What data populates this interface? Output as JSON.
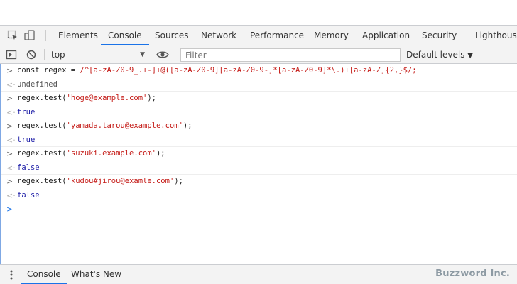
{
  "devtools": {
    "tabs": [
      {
        "label": "Elements",
        "active": false
      },
      {
        "label": "Console",
        "active": true
      },
      {
        "label": "Sources",
        "active": false
      },
      {
        "label": "Network",
        "active": false
      },
      {
        "label": "Performance",
        "active": false
      },
      {
        "label": "Memory",
        "active": false
      },
      {
        "label": "Application",
        "active": false
      },
      {
        "label": "Security",
        "active": false
      },
      {
        "label": "Lighthouse",
        "active": false
      }
    ]
  },
  "toolbar": {
    "context": "top",
    "filter_placeholder": "Filter",
    "filter_value": "",
    "levels_label": "Default levels",
    "icons": [
      "inspect-element-icon",
      "device-toolbar-icon",
      "sidebar-toggle-icon",
      "clear-console-icon",
      "eye-icon",
      "dropdown-arrow-icon"
    ]
  },
  "console": {
    "lines": [
      {
        "kind": "input",
        "text": "const regex = ",
        "regex": "/^[a-zA-Z0-9_.+-]+@([a-zA-Z0-9][a-zA-Z0-9-]*[a-zA-Z0-9]*\\.)+[a-zA-Z]{2,}$/;"
      },
      {
        "kind": "output",
        "text": "undefined"
      },
      {
        "kind": "input",
        "text": "regex.test(",
        "string": "'hoge@example.com'",
        "suffix": ");"
      },
      {
        "kind": "output",
        "text": "true"
      },
      {
        "kind": "input",
        "text": "regex.test(",
        "string": "'yamada.tarou@example.com'",
        "suffix": ");"
      },
      {
        "kind": "output",
        "text": "true"
      },
      {
        "kind": "input",
        "text": "regex.test(",
        "string": "'suzuki.example.com'",
        "suffix": ");"
      },
      {
        "kind": "output",
        "text": "false"
      },
      {
        "kind": "input",
        "text": "regex.test(",
        "string": "'kudou#jirou@examle.com'",
        "suffix": ");"
      },
      {
        "kind": "output",
        "text": "false"
      }
    ]
  },
  "drawer": {
    "tabs": [
      {
        "label": "Console",
        "active": true
      },
      {
        "label": "What's New",
        "active": false
      }
    ],
    "watermark": "Buzzword Inc."
  },
  "colors": {
    "accent": "#1a73e8",
    "string": "#c41a16",
    "boolean": "#1a1aa6"
  }
}
